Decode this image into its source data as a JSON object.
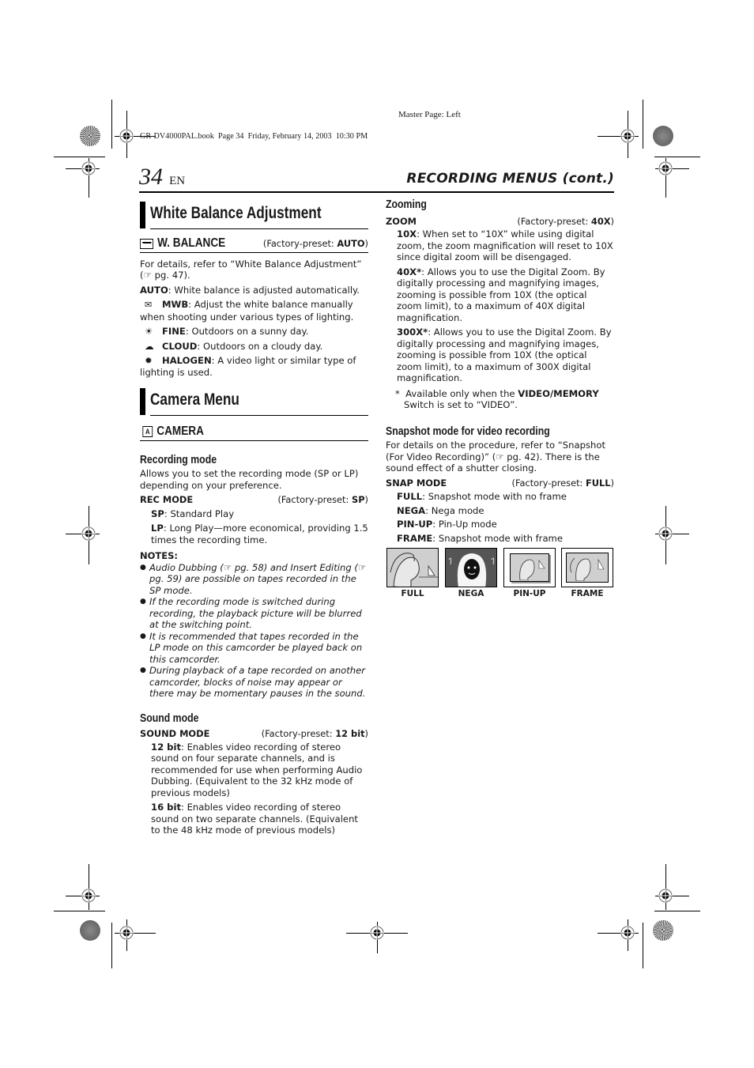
{
  "print_meta": {
    "master_page": "Master Page: Left",
    "book_info": "GR-DV4000PAL.book  Page 34  Friday, February 14, 2003  10:30 PM"
  },
  "header": {
    "page_number": "34",
    "language": "EN",
    "running_title": "RECORDING MENUS (cont.)"
  },
  "white_balance": {
    "heading": "White Balance Adjustment",
    "menu_item": {
      "icon": "white-balance-icon",
      "label": "W. BALANCE",
      "preset_prefix": "(Factory-preset: ",
      "preset_value": "AUTO",
      "preset_suffix": ")"
    },
    "intro": "For details, refer to “White Balance Adjustment” (☞ pg. 47).",
    "options": [
      {
        "icon": "",
        "name": "AUTO",
        "desc": ": White balance is adjusted automatically."
      },
      {
        "icon": "manual-wb-icon",
        "name": "MWB",
        "desc": ": Adjust the white balance manually when shooting under various types of lighting."
      },
      {
        "icon": "sun-icon",
        "name": "FINE",
        "desc": ": Outdoors on a sunny day."
      },
      {
        "icon": "cloud-icon",
        "name": "CLOUD",
        "desc": ": Outdoors on a cloudy day."
      },
      {
        "icon": "halogen-icon",
        "name": "HALOGEN",
        "desc": ": A video light or similar type of lighting is used."
      }
    ]
  },
  "camera_menu": {
    "heading": "Camera Menu",
    "menu_item": {
      "icon": "camera-a-icon",
      "label": "CAMERA"
    },
    "recording_mode": {
      "heading": "Recording mode",
      "intro": "Allows you to set the recording mode (SP or LP) depending on your preference.",
      "setting": "REC MODE",
      "preset_prefix": "(Factory-preset: ",
      "preset_value": "SP",
      "preset_suffix": ")",
      "options": [
        {
          "name": "SP",
          "desc": ": Standard Play"
        },
        {
          "name": "LP",
          "desc": ": Long Play—more economical, providing 1.5 times the recording time."
        }
      ]
    },
    "notes": {
      "heading": "NOTES:",
      "items": [
        "Audio Dubbing (☞ pg. 58) and Insert Editing (☞ pg. 59) are possible on tapes recorded in the SP mode.",
        "If the recording mode is switched during recording, the playback picture will be blurred at the switching point.",
        "It is recommended that tapes recorded in the LP mode on this camcorder be played back on this camcorder.",
        "During playback of a tape recorded on another camcorder, blocks of noise may appear or there may be momentary pauses in the sound."
      ]
    },
    "sound_mode": {
      "heading": "Sound mode",
      "setting": "SOUND MODE",
      "preset_prefix": "(Factory-preset: ",
      "preset_value": "12 bit",
      "preset_suffix": ")",
      "options": [
        {
          "name": "12 bit",
          "desc": ": Enables video recording of stereo sound on four separate channels, and is recommended for use when performing Audio Dubbing. (Equivalent to the 32 kHz mode of previous models)"
        },
        {
          "name": "16 bit",
          "desc": ": Enables video recording of stereo sound on two separate channels. (Equivalent to the 48 kHz mode of previous models)"
        }
      ]
    }
  },
  "zooming": {
    "heading": "Zooming",
    "setting": "ZOOM",
    "preset_prefix": "(Factory-preset: ",
    "preset_value": "40X",
    "preset_suffix": ")",
    "options": [
      {
        "name": "10X",
        "desc": ": When set to “10X” while using digital zoom, the zoom magnification will reset to 10X since digital zoom will be disengaged."
      },
      {
        "name": "40X*",
        "desc": ": Allows you to use the Digital Zoom. By digitally processing and magnifying images, zooming is possible from 10X (the optical zoom limit), to a maximum of 40X digital magnification."
      },
      {
        "name": "300X*",
        "desc": ": Allows you to use the Digital Zoom. By digitally processing and magnifying images, zooming is possible from 10X (the optical zoom limit), to a maximum of 300X digital magnification."
      }
    ],
    "footnote_prefix": "Available only when the ",
    "footnote_bold": "VIDEO/MEMORY",
    "footnote_suffix": " Switch is set to “VIDEO”."
  },
  "snapshot": {
    "heading": "Snapshot mode for video recording",
    "intro": "For details on the procedure, refer to “Snapshot (For Video Recording)” (☞ pg. 42). There is the sound effect of a shutter closing.",
    "setting": "SNAP MODE",
    "preset_prefix": "(Factory-preset: ",
    "preset_value": "FULL",
    "preset_suffix": ")",
    "options": [
      {
        "name": "FULL",
        "desc": ": Snapshot mode with no frame"
      },
      {
        "name": "NEGA",
        "desc": ": Nega mode"
      },
      {
        "name": "PIN-UP",
        "desc": ": Pin-Up mode"
      },
      {
        "name": "FRAME",
        "desc": ": Snapshot mode with frame"
      }
    ],
    "thumbnails": [
      "FULL",
      "NEGA",
      "PIN-UP",
      "FRAME"
    ]
  }
}
